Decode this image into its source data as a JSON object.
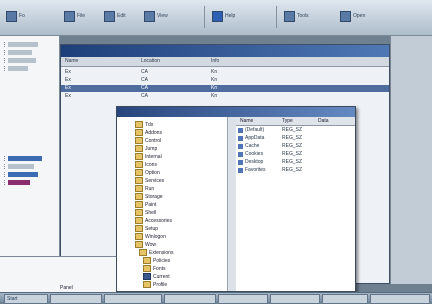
{
  "toolbar": {
    "buttons": [
      {
        "label": "Fo",
        "icon": "folder-icon"
      },
      {
        "label": "File",
        "icon": "file-icon"
      },
      {
        "label": "Edit",
        "icon": "edit-icon"
      },
      {
        "label": "View",
        "icon": "view-icon"
      },
      {
        "label": "Help",
        "icon": "help-icon"
      },
      {
        "label": "Tools",
        "icon": "tools-icon"
      },
      {
        "label": "Open",
        "icon": "open-icon"
      }
    ]
  },
  "main_window": {
    "title": "",
    "columns": [
      "Name",
      "Location",
      "Info"
    ],
    "rows": [
      {
        "name": "Ex",
        "location": "CA",
        "info": "Kn"
      },
      {
        "name": "Ex",
        "location": "CA",
        "info": "Kn"
      },
      {
        "name": "Ex",
        "location": "CA",
        "info": "Kn"
      },
      {
        "name": "Ex",
        "location": "CA",
        "info": "Kn"
      }
    ]
  },
  "registry_window": {
    "tree_nodes": [
      "Tdx",
      "Addons",
      "Control",
      "Jump",
      "Internal",
      "Icons",
      "Option",
      "Services",
      "Run",
      "Storage",
      "Paint",
      "Shell",
      "Accessories",
      "Setup",
      "Winlogon",
      "Wow",
      "Extensions",
      "Policies",
      "Fonts",
      "Current",
      "Profile"
    ],
    "selected_node": "Current",
    "list_columns": [
      "Name",
      "Type",
      "Data"
    ],
    "list_rows": [
      {
        "name": "(Default)",
        "type": "REG_SZ",
        "data": ""
      },
      {
        "name": "AppData",
        "type": "REG_SZ",
        "data": ""
      },
      {
        "name": "Cache",
        "type": "REG_SZ",
        "data": ""
      },
      {
        "name": "Cookies",
        "type": "REG_SZ",
        "data": ""
      },
      {
        "name": "Desktop",
        "type": "REG_SZ",
        "data": ""
      },
      {
        "name": "Favorites",
        "type": "REG_SZ",
        "data": ""
      }
    ]
  },
  "bottom_panel": {
    "label": "Panel"
  },
  "taskbar": {
    "items": [
      "Start",
      "",
      "",
      "",
      "",
      "",
      "",
      ""
    ]
  }
}
